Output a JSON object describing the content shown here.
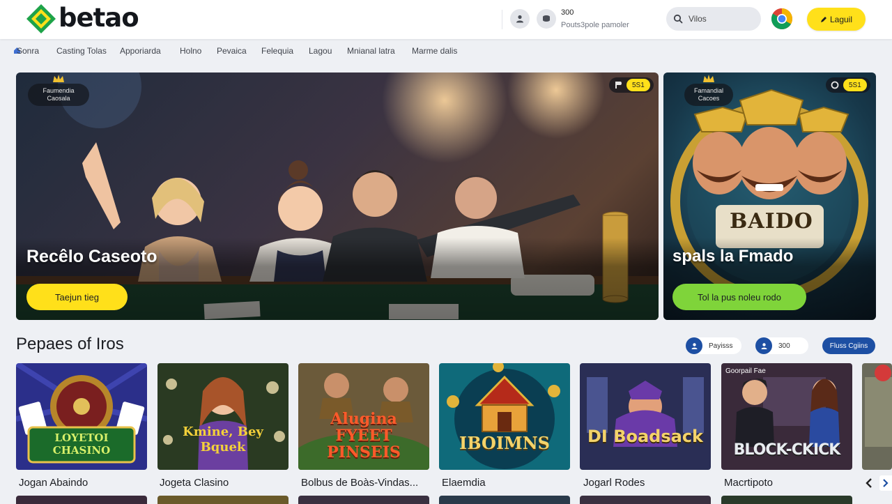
{
  "brand": {
    "name": "betao",
    "colors": {
      "green": "#1ea349",
      "yellow": "#ffe01a",
      "blue": "#1d4fa3"
    }
  },
  "header": {
    "user_icon": "user-icon",
    "coin_icon": "coin-icon",
    "balance": "300",
    "balance_sub": "Pouts3pole pamoler",
    "search": {
      "placeholder": "Vilos",
      "icon": "search-icon"
    },
    "browser_icon": "chrome-icon",
    "login_label": "Laguil"
  },
  "nav": {
    "items": [
      {
        "label": "Sonra"
      },
      {
        "label": "Casting Tolas"
      },
      {
        "label": "Apporiarda"
      },
      {
        "label": "Holno"
      },
      {
        "label": "Pevaica"
      },
      {
        "label": "Felequia"
      },
      {
        "label": "Lagou"
      },
      {
        "label": "Mnianal latra"
      },
      {
        "label": "Marme dalis"
      }
    ]
  },
  "banners": {
    "main": {
      "badge": "Faumendia Caosala",
      "pill_value": "5S1",
      "title": "Recêlo Caseoto",
      "button": "Taejun tieg"
    },
    "side": {
      "badge": "Famandial Cacoes",
      "pill_value": "5S1",
      "art_text": "BAIDO",
      "title": "spals la Fmado",
      "button": "Tol la pus noleu rodo"
    }
  },
  "section": {
    "title": "Pepaes of Iros",
    "controls": [
      {
        "label": "Payisss"
      },
      {
        "label": "300"
      },
      {
        "label": "Fluss Cgiins"
      }
    ]
  },
  "games": [
    {
      "art_text": "LOYETOI CHASINO",
      "name": "Jogan Abaindo"
    },
    {
      "art_text": "Kmine, Bey Bquek",
      "name": "Jogeta Clasino"
    },
    {
      "art_text": "Alugina FYEET PINSEIS",
      "name": "Bolbus de Boàs-Vindas..."
    },
    {
      "art_text": "IBOIMNS",
      "name": "Elaemdia"
    },
    {
      "art_text": "DI Boadsack",
      "name": "Jogarl Rodes"
    },
    {
      "art_text": "BLOCK-CKICK",
      "tag": "Goorpail Fae",
      "name": "Macrtipoto"
    }
  ]
}
